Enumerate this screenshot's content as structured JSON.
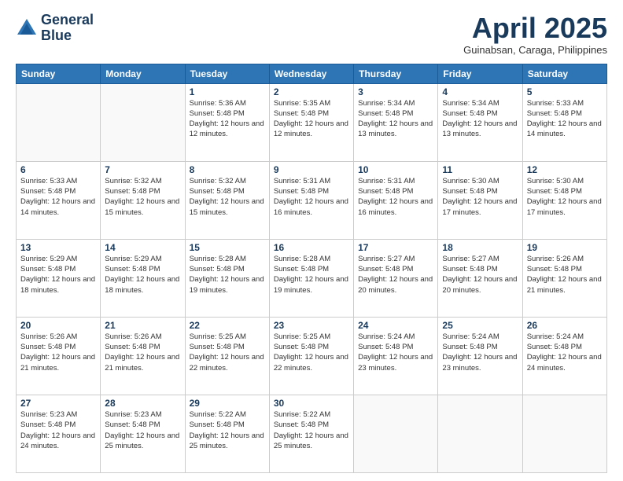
{
  "logo": {
    "line1": "General",
    "line2": "Blue"
  },
  "header": {
    "title": "April 2025",
    "subtitle": "Guinabsan, Caraga, Philippines"
  },
  "weekdays": [
    "Sunday",
    "Monday",
    "Tuesday",
    "Wednesday",
    "Thursday",
    "Friday",
    "Saturday"
  ],
  "weeks": [
    [
      {
        "day": "",
        "sunrise": "",
        "sunset": "",
        "daylight": ""
      },
      {
        "day": "",
        "sunrise": "",
        "sunset": "",
        "daylight": ""
      },
      {
        "day": "1",
        "sunrise": "Sunrise: 5:36 AM",
        "sunset": "Sunset: 5:48 PM",
        "daylight": "Daylight: 12 hours and 12 minutes."
      },
      {
        "day": "2",
        "sunrise": "Sunrise: 5:35 AM",
        "sunset": "Sunset: 5:48 PM",
        "daylight": "Daylight: 12 hours and 12 minutes."
      },
      {
        "day": "3",
        "sunrise": "Sunrise: 5:34 AM",
        "sunset": "Sunset: 5:48 PM",
        "daylight": "Daylight: 12 hours and 13 minutes."
      },
      {
        "day": "4",
        "sunrise": "Sunrise: 5:34 AM",
        "sunset": "Sunset: 5:48 PM",
        "daylight": "Daylight: 12 hours and 13 minutes."
      },
      {
        "day": "5",
        "sunrise": "Sunrise: 5:33 AM",
        "sunset": "Sunset: 5:48 PM",
        "daylight": "Daylight: 12 hours and 14 minutes."
      }
    ],
    [
      {
        "day": "6",
        "sunrise": "Sunrise: 5:33 AM",
        "sunset": "Sunset: 5:48 PM",
        "daylight": "Daylight: 12 hours and 14 minutes."
      },
      {
        "day": "7",
        "sunrise": "Sunrise: 5:32 AM",
        "sunset": "Sunset: 5:48 PM",
        "daylight": "Daylight: 12 hours and 15 minutes."
      },
      {
        "day": "8",
        "sunrise": "Sunrise: 5:32 AM",
        "sunset": "Sunset: 5:48 PM",
        "daylight": "Daylight: 12 hours and 15 minutes."
      },
      {
        "day": "9",
        "sunrise": "Sunrise: 5:31 AM",
        "sunset": "Sunset: 5:48 PM",
        "daylight": "Daylight: 12 hours and 16 minutes."
      },
      {
        "day": "10",
        "sunrise": "Sunrise: 5:31 AM",
        "sunset": "Sunset: 5:48 PM",
        "daylight": "Daylight: 12 hours and 16 minutes."
      },
      {
        "day": "11",
        "sunrise": "Sunrise: 5:30 AM",
        "sunset": "Sunset: 5:48 PM",
        "daylight": "Daylight: 12 hours and 17 minutes."
      },
      {
        "day": "12",
        "sunrise": "Sunrise: 5:30 AM",
        "sunset": "Sunset: 5:48 PM",
        "daylight": "Daylight: 12 hours and 17 minutes."
      }
    ],
    [
      {
        "day": "13",
        "sunrise": "Sunrise: 5:29 AM",
        "sunset": "Sunset: 5:48 PM",
        "daylight": "Daylight: 12 hours and 18 minutes."
      },
      {
        "day": "14",
        "sunrise": "Sunrise: 5:29 AM",
        "sunset": "Sunset: 5:48 PM",
        "daylight": "Daylight: 12 hours and 18 minutes."
      },
      {
        "day": "15",
        "sunrise": "Sunrise: 5:28 AM",
        "sunset": "Sunset: 5:48 PM",
        "daylight": "Daylight: 12 hours and 19 minutes."
      },
      {
        "day": "16",
        "sunrise": "Sunrise: 5:28 AM",
        "sunset": "Sunset: 5:48 PM",
        "daylight": "Daylight: 12 hours and 19 minutes."
      },
      {
        "day": "17",
        "sunrise": "Sunrise: 5:27 AM",
        "sunset": "Sunset: 5:48 PM",
        "daylight": "Daylight: 12 hours and 20 minutes."
      },
      {
        "day": "18",
        "sunrise": "Sunrise: 5:27 AM",
        "sunset": "Sunset: 5:48 PM",
        "daylight": "Daylight: 12 hours and 20 minutes."
      },
      {
        "day": "19",
        "sunrise": "Sunrise: 5:26 AM",
        "sunset": "Sunset: 5:48 PM",
        "daylight": "Daylight: 12 hours and 21 minutes."
      }
    ],
    [
      {
        "day": "20",
        "sunrise": "Sunrise: 5:26 AM",
        "sunset": "Sunset: 5:48 PM",
        "daylight": "Daylight: 12 hours and 21 minutes."
      },
      {
        "day": "21",
        "sunrise": "Sunrise: 5:26 AM",
        "sunset": "Sunset: 5:48 PM",
        "daylight": "Daylight: 12 hours and 21 minutes."
      },
      {
        "day": "22",
        "sunrise": "Sunrise: 5:25 AM",
        "sunset": "Sunset: 5:48 PM",
        "daylight": "Daylight: 12 hours and 22 minutes."
      },
      {
        "day": "23",
        "sunrise": "Sunrise: 5:25 AM",
        "sunset": "Sunset: 5:48 PM",
        "daylight": "Daylight: 12 hours and 22 minutes."
      },
      {
        "day": "24",
        "sunrise": "Sunrise: 5:24 AM",
        "sunset": "Sunset: 5:48 PM",
        "daylight": "Daylight: 12 hours and 23 minutes."
      },
      {
        "day": "25",
        "sunrise": "Sunrise: 5:24 AM",
        "sunset": "Sunset: 5:48 PM",
        "daylight": "Daylight: 12 hours and 23 minutes."
      },
      {
        "day": "26",
        "sunrise": "Sunrise: 5:24 AM",
        "sunset": "Sunset: 5:48 PM",
        "daylight": "Daylight: 12 hours and 24 minutes."
      }
    ],
    [
      {
        "day": "27",
        "sunrise": "Sunrise: 5:23 AM",
        "sunset": "Sunset: 5:48 PM",
        "daylight": "Daylight: 12 hours and 24 minutes."
      },
      {
        "day": "28",
        "sunrise": "Sunrise: 5:23 AM",
        "sunset": "Sunset: 5:48 PM",
        "daylight": "Daylight: 12 hours and 25 minutes."
      },
      {
        "day": "29",
        "sunrise": "Sunrise: 5:22 AM",
        "sunset": "Sunset: 5:48 PM",
        "daylight": "Daylight: 12 hours and 25 minutes."
      },
      {
        "day": "30",
        "sunrise": "Sunrise: 5:22 AM",
        "sunset": "Sunset: 5:48 PM",
        "daylight": "Daylight: 12 hours and 25 minutes."
      },
      {
        "day": "",
        "sunrise": "",
        "sunset": "",
        "daylight": ""
      },
      {
        "day": "",
        "sunrise": "",
        "sunset": "",
        "daylight": ""
      },
      {
        "day": "",
        "sunrise": "",
        "sunset": "",
        "daylight": ""
      }
    ]
  ]
}
